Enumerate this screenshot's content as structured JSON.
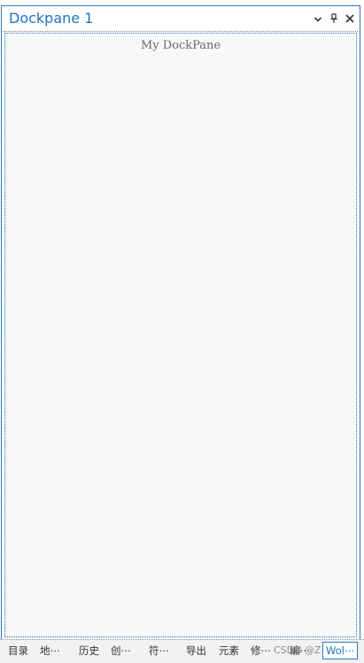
{
  "dockpane": {
    "title": "Dockpane 1",
    "content_text": "My DockPane",
    "controls": {
      "options_icon": "chevron-down-icon",
      "pin_icon": "pin-icon",
      "close_icon": "close-icon"
    }
  },
  "tabs": [
    {
      "label": "目录"
    },
    {
      "label": "地⋯"
    },
    {
      "label": "历史"
    },
    {
      "label": "创⋯"
    },
    {
      "label": "符⋯"
    },
    {
      "label": "导出"
    },
    {
      "label": "元素"
    },
    {
      "label": "修⋯"
    },
    {
      "label": "编⋯"
    },
    {
      "label": "Wol⋯",
      "active": true
    }
  ],
  "watermark": "CSDN @Z",
  "colors": {
    "accent": "#1f73bf",
    "border": "#2b79c2",
    "background": "#f7f8f8"
  }
}
